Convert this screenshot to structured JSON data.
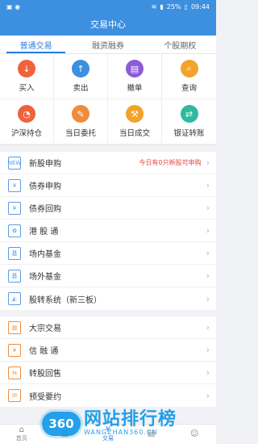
{
  "status": {
    "battery": "25%",
    "time": "09:44",
    "left_icons": "▣ ◉"
  },
  "title": "交易中心",
  "tabs": [
    {
      "label": "普通交易",
      "active": true
    },
    {
      "label": "融资融券",
      "active": false
    },
    {
      "label": "个股期权",
      "active": false
    }
  ],
  "grid": [
    {
      "label": "买入",
      "icon": "download-icon",
      "glyph": "↓",
      "color": "#f0623c"
    },
    {
      "label": "卖出",
      "icon": "upload-icon",
      "glyph": "↑",
      "color": "#3d8fe0"
    },
    {
      "label": "撤单",
      "icon": "cancel-order-icon",
      "glyph": "▤",
      "color": "#8b5cd6"
    },
    {
      "label": "查询",
      "icon": "search-icon",
      "glyph": "⌕",
      "color": "#f3a32b"
    },
    {
      "label": "沪深持仓",
      "icon": "pie-chart-icon",
      "glyph": "◔",
      "color": "#f0623c"
    },
    {
      "label": "当日委托",
      "icon": "document-icon",
      "glyph": "✎",
      "color": "#f08c3c"
    },
    {
      "label": "当日成交",
      "icon": "gavel-icon",
      "glyph": "⚒",
      "color": "#f3a32b"
    },
    {
      "label": "银证转账",
      "icon": "transfer-icon",
      "glyph": "⇄",
      "color": "#30b8a0"
    }
  ],
  "section1": [
    {
      "label": "新股申购",
      "icon": "new-icon",
      "glyph": "NEW",
      "note": "今日有0只新股可申购"
    },
    {
      "label": "债券申购",
      "icon": "bond-icon",
      "glyph": "¥"
    },
    {
      "label": "债券回购",
      "icon": "repo-icon",
      "glyph": "¥"
    },
    {
      "label": "港 股 通",
      "icon": "hk-icon",
      "glyph": "✿"
    },
    {
      "label": "场内基金",
      "icon": "fund-icon",
      "glyph": "基"
    },
    {
      "label": "场外基金",
      "icon": "otc-fund-icon",
      "glyph": "基"
    },
    {
      "label": "股转系统（新三板）",
      "icon": "share-transfer-icon",
      "glyph": "◭"
    }
  ],
  "section2": [
    {
      "label": "大宗交易",
      "icon": "block-trade-icon",
      "glyph": "▥"
    },
    {
      "label": "信 融 通",
      "icon": "credit-icon",
      "glyph": "¥"
    },
    {
      "label": "转股回售",
      "icon": "convert-icon",
      "glyph": "⇆"
    },
    {
      "label": "预受要约",
      "icon": "tender-offer-icon",
      "glyph": "✉"
    }
  ],
  "nav": [
    {
      "label": "首页",
      "icon": "home-icon",
      "glyph": "⌂",
      "active": false
    },
    {
      "label": "",
      "icon": "market-icon",
      "glyph": "▦",
      "active": false
    },
    {
      "label": "交易",
      "icon": "trade-icon",
      "glyph": "¥",
      "active": true
    },
    {
      "label": "",
      "icon": "news-icon",
      "glyph": "▤",
      "active": false
    },
    {
      "label": "",
      "icon": "mine-icon",
      "glyph": "☺",
      "active": false
    }
  ],
  "watermark": {
    "badge": "360",
    "cn": "网站排行榜",
    "en": "WANGZHAN360.CN"
  }
}
